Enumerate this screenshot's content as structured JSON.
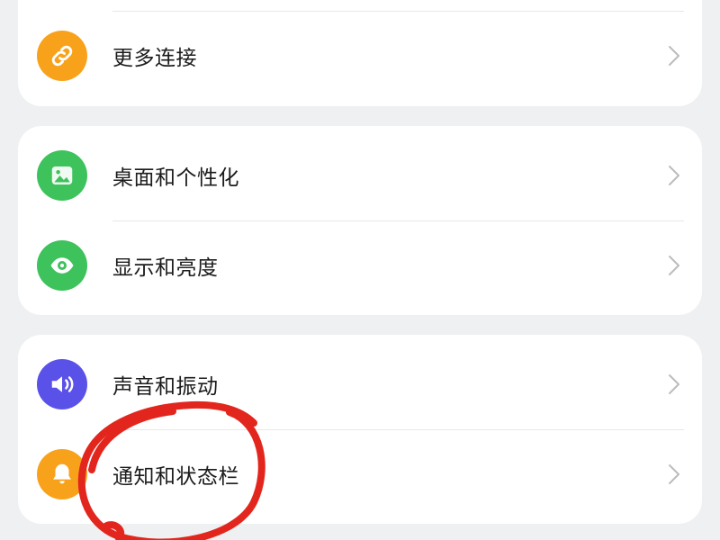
{
  "theme": {
    "background": "#eef0f2",
    "card": "#ffffff",
    "text": "#1c1c1c",
    "divider": "#e7e7e7",
    "chevron": "#bcbcbc"
  },
  "settings": {
    "groups": [
      {
        "items": [
          {
            "label": "更多连接",
            "icon": "link-icon",
            "icon_color": "#f8a21b"
          }
        ]
      },
      {
        "items": [
          {
            "label": "桌面和个性化",
            "icon": "image-icon",
            "icon_color": "#3dc25c"
          },
          {
            "label": "显示和亮度",
            "icon": "eye-icon",
            "icon_color": "#3dc25c"
          }
        ]
      },
      {
        "items": [
          {
            "label": "声音和振动",
            "icon": "volume-icon",
            "icon_color": "#5a52e8"
          },
          {
            "label": "通知和状态栏",
            "icon": "bell-icon",
            "icon_color": "#f8a21b"
          }
        ]
      }
    ],
    "chevron_icon": "chevron-right-icon"
  },
  "annotation": {
    "icon": "red-circle-mark",
    "color": "#e3261d"
  }
}
